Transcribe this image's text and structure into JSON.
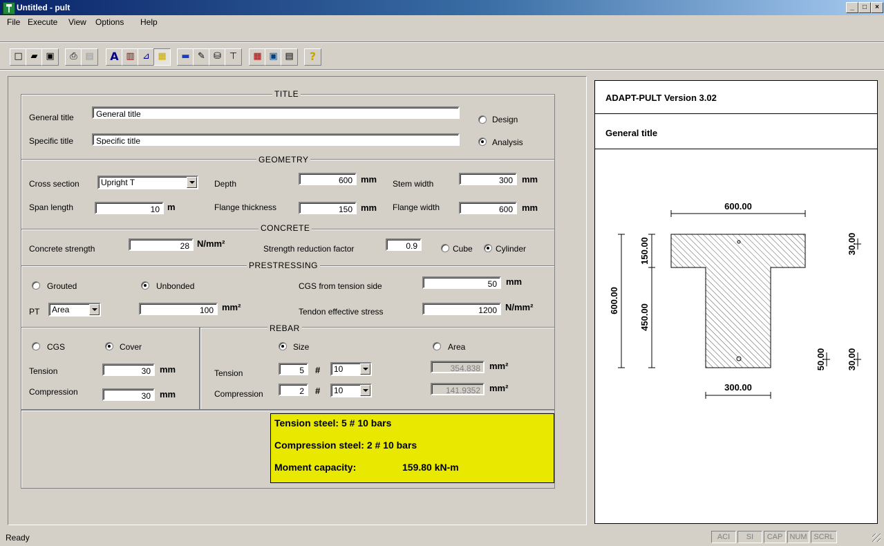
{
  "window": {
    "title": "Untitled - pult",
    "min": "_",
    "max": "□",
    "close": "×"
  },
  "menu": [
    "File",
    "Execute",
    "View",
    "Options",
    "Help"
  ],
  "toolbar_icons": [
    "new-icon",
    "open-icon",
    "save-icon",
    "print-icon",
    "print-preview-icon",
    "font-icon",
    "chart-icon",
    "section-icon",
    "rebar-icon",
    "blue-rect-icon",
    "pencil-icon",
    "cylinder-icon",
    "minus-icon",
    "grid-icon",
    "monitor-icon",
    "document-icon",
    "help-icon"
  ],
  "title_section": {
    "heading": "TITLE",
    "general_label": "General title",
    "general_value": "General title",
    "specific_label": "Specific title",
    "specific_value": "Specific title",
    "design_label": "Design",
    "analysis_label": "Analysis"
  },
  "geometry": {
    "heading": "GEOMETRY",
    "cross_section_label": "Cross section",
    "cross_section_value": "Upright T",
    "depth_label": "Depth",
    "depth_value": "600",
    "depth_unit": "mm",
    "stem_label": "Stem width",
    "stem_value": "300",
    "stem_unit": "mm",
    "span_label": "Span length",
    "span_value": "10",
    "span_unit": "m",
    "flange_thk_label": "Flange thickness",
    "flange_thk_value": "150",
    "flange_thk_unit": "mm",
    "flange_w_label": "Flange width",
    "flange_w_value": "600",
    "flange_w_unit": "mm"
  },
  "concrete": {
    "heading": "CONCRETE",
    "strength_label": "Concrete strength",
    "strength_value": "28",
    "strength_unit": "N/mm²",
    "reduction_label": "Strength reduction factor",
    "reduction_value": "0.9",
    "cube_label": "Cube",
    "cylinder_label": "Cylinder"
  },
  "prestressing": {
    "heading": "PRESTRESSING",
    "grouted_label": "Grouted",
    "unbonded_label": "Unbonded",
    "cgs_label": "CGS from tension side",
    "cgs_value": "50",
    "cgs_unit": "mm",
    "pt_label": "PT",
    "pt_value": "Area",
    "area_value": "100",
    "area_unit": "mm²",
    "stress_label": "Tendon effective stress",
    "stress_value": "1200",
    "stress_unit": "N/mm²"
  },
  "rebar": {
    "heading": "REBAR",
    "cgs_label": "CGS",
    "cover_label": "Cover",
    "tension_label": "Tension",
    "tension_value": "30",
    "tension_unit": "mm",
    "compression_label": "Compression",
    "compression_value": "30",
    "compression_unit": "mm",
    "size_label": "Size",
    "area_label": "Area",
    "r_tension_label": "Tension",
    "r_tension_count": "5",
    "hash": "#",
    "r_tension_size": "10",
    "r_tension_area": "354.838",
    "r_area_unit": "mm²",
    "r_compression_label": "Compression",
    "r_compression_count": "2",
    "r_compression_size": "10",
    "r_compression_area": "141.9352"
  },
  "results": {
    "tension": "Tension steel: 5 # 10 bars",
    "compression": "Compression steel: 2 # 10 bars",
    "moment_label": "Moment capacity:",
    "moment_value": "159.80 kN-m"
  },
  "preview": {
    "version": "ADAPT-PULT Version 3.02",
    "title": "General title",
    "dims": {
      "top": "600.00",
      "bottom": "300.00",
      "height": "600.00",
      "flange": "150.00",
      "stem": "450.00",
      "right_top": "30.00",
      "right_b1": "50.00",
      "right_b2": "30.00"
    }
  },
  "status": {
    "text": "Ready",
    "panels": [
      "ACI",
      "SI",
      "CAP",
      "NUM",
      "SCRL"
    ]
  }
}
